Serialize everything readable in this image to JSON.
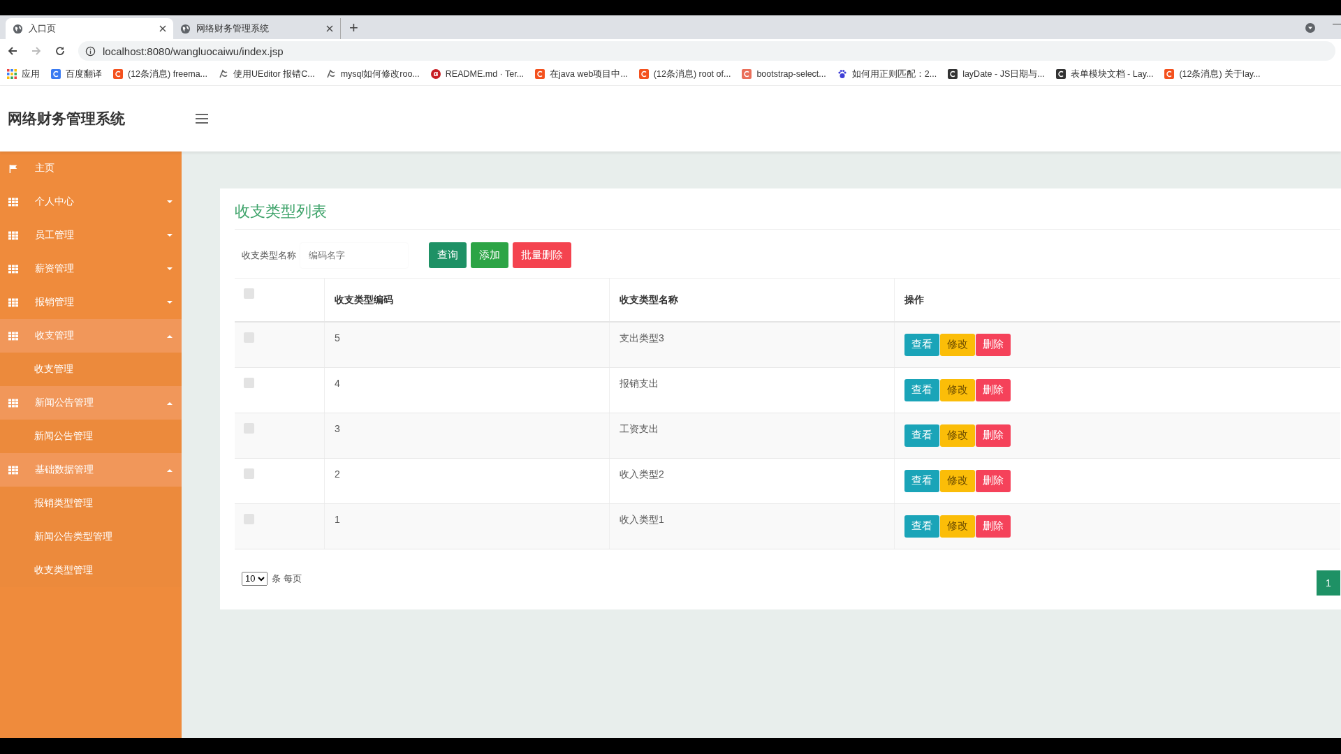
{
  "browser": {
    "tabs": [
      {
        "title": "入口页",
        "selected": true
      },
      {
        "title": "网络财务管理系统",
        "selected": false
      }
    ],
    "new_tab": "+",
    "url": "localhost:8080/wangluocaiwu/index.jsp",
    "bookmarks": [
      {
        "kind": "apps",
        "label": "应用"
      },
      {
        "kind": "translate",
        "label": "百度翻译"
      },
      {
        "kind": "csdn",
        "label": "(12条消息) freema..."
      },
      {
        "kind": "editor",
        "label": "使用UEditor 报错C..."
      },
      {
        "kind": "editor",
        "label": "mysql如何修改roo..."
      },
      {
        "kind": "gitee",
        "label": "README.md · Ter..."
      },
      {
        "kind": "csdn",
        "label": "在java web项目中..."
      },
      {
        "kind": "csdn",
        "label": "(12条消息) root of..."
      },
      {
        "kind": "jianshu",
        "label": "bootstrap-select..."
      },
      {
        "kind": "baidu",
        "label": "如何用正则匹配：2..."
      },
      {
        "kind": "layui",
        "label": "layDate - JS日期与..."
      },
      {
        "kind": "layui",
        "label": "表单模块文档 - Lay..."
      },
      {
        "kind": "csdn",
        "label": "(12条消息) 关于lay..."
      }
    ]
  },
  "app": {
    "title": "网络财务管理系统"
  },
  "sidebar": {
    "items": [
      {
        "kind": "home",
        "label": "主页"
      },
      {
        "kind": "group",
        "label": "个人中心",
        "expanded": false
      },
      {
        "kind": "group",
        "label": "员工管理",
        "expanded": false
      },
      {
        "kind": "group",
        "label": "薪资管理",
        "expanded": false
      },
      {
        "kind": "group",
        "label": "报销管理",
        "expanded": false
      },
      {
        "kind": "group",
        "label": "收支管理",
        "expanded": true,
        "children": [
          {
            "label": "收支管理"
          }
        ]
      },
      {
        "kind": "group",
        "label": "新闻公告管理",
        "expanded": true,
        "children": [
          {
            "label": "新闻公告管理"
          }
        ]
      },
      {
        "kind": "group",
        "label": "基础数据管理",
        "expanded": true,
        "children": [
          {
            "label": "报销类型管理"
          },
          {
            "label": "新闻公告类型管理"
          },
          {
            "label": "收支类型管理"
          }
        ]
      }
    ]
  },
  "panel": {
    "title": "收支类型列表",
    "search": {
      "label": "收支类型名称",
      "placeholder": "编码名字"
    },
    "buttons": [
      {
        "kind": "search",
        "label": "查询"
      },
      {
        "kind": "add",
        "label": "添加"
      },
      {
        "kind": "delete",
        "label": "批量删除"
      }
    ],
    "table": {
      "header_checked": false,
      "columns": [
        "收支类型编码",
        "收支类型名称",
        "操作"
      ],
      "rows": [
        {
          "checked": false,
          "code": "5",
          "name": "支出类型3",
          "actions": [
            {
              "kind": "view",
              "label": "查看"
            },
            {
              "kind": "edit",
              "label": "修改"
            },
            {
              "kind": "delete",
              "label": "删除"
            }
          ]
        },
        {
          "checked": false,
          "code": "4",
          "name": "报销支出",
          "actions": [
            {
              "kind": "view",
              "label": "查看"
            },
            {
              "kind": "edit",
              "label": "修改"
            },
            {
              "kind": "delete",
              "label": "删除"
            }
          ]
        },
        {
          "checked": false,
          "code": "3",
          "name": "工资支出",
          "actions": [
            {
              "kind": "view",
              "label": "查看"
            },
            {
              "kind": "edit",
              "label": "修改"
            },
            {
              "kind": "delete",
              "label": "删除"
            }
          ]
        },
        {
          "checked": false,
          "code": "2",
          "name": "收入类型2",
          "actions": [
            {
              "kind": "view",
              "label": "查看"
            },
            {
              "kind": "edit",
              "label": "修改"
            },
            {
              "kind": "delete",
              "label": "删除"
            }
          ]
        },
        {
          "checked": false,
          "code": "1",
          "name": "收入类型1",
          "actions": [
            {
              "kind": "view",
              "label": "查看"
            },
            {
              "kind": "edit",
              "label": "修改"
            },
            {
              "kind": "delete",
              "label": "删除"
            }
          ]
        }
      ]
    },
    "pagination": {
      "page_size": "10",
      "page_size_label": "条 每页",
      "pages": [
        {
          "label": "1",
          "selected": true
        }
      ]
    }
  }
}
